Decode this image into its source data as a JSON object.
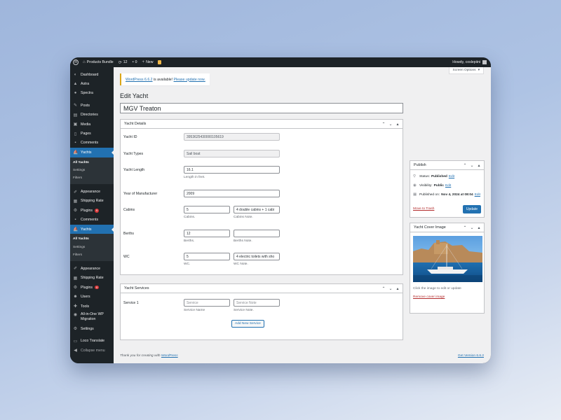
{
  "adminbar": {
    "site_name": "Products Bundle",
    "updates_count": "12",
    "comments_count": "0",
    "new_label": "New",
    "howdy": "Howdy, coslepiini"
  },
  "sidebar": {
    "items_top": [
      {
        "label": "Dashboard",
        "icon": "dashboard-icon"
      },
      {
        "label": "Astra",
        "icon": "astra-icon"
      },
      {
        "label": "Spectra",
        "icon": "spectra-icon"
      }
    ],
    "items_mid": [
      {
        "label": "Posts",
        "icon": "pin-icon"
      },
      {
        "label": "Directories",
        "icon": "directories-icon"
      },
      {
        "label": "Media",
        "icon": "media-icon"
      },
      {
        "label": "Pages",
        "icon": "pages-icon"
      },
      {
        "label": "Comments",
        "icon": "comments-icon"
      }
    ],
    "yachts_label": "Yachts",
    "submenu": [
      "All Yachts",
      "Settings",
      "Filters"
    ],
    "items_after": [
      {
        "label": "Appearance",
        "icon": "appearance-icon"
      },
      {
        "label": "Shipping Rate",
        "icon": "shipping-icon"
      },
      {
        "label": "Plugins",
        "icon": "plugins-icon",
        "badge": "9"
      },
      {
        "label": "Comments",
        "icon": "comments-icon"
      }
    ],
    "items_bottom": [
      {
        "label": "Appearance",
        "icon": "appearance-icon"
      },
      {
        "label": "Shipping Rate",
        "icon": "shipping-icon"
      },
      {
        "label": "Plugins",
        "icon": "plugins-icon",
        "badge": "9"
      },
      {
        "label": "Users",
        "icon": "users-icon"
      },
      {
        "label": "Tools",
        "icon": "tools-icon"
      },
      {
        "label": "All-in-One WP",
        "label2": "Migration",
        "icon": "migration-icon"
      },
      {
        "label": "Settings",
        "icon": "settings-icon"
      }
    ],
    "loco_label": "Loco Translate",
    "collapse_label": "Collapse menu"
  },
  "main": {
    "screen_options": "Screen Options",
    "notice_link": "WordPress 6.6.2",
    "notice_text": " is available! ",
    "notice_update_link": "Please update now.",
    "page_title": "Edit Yacht",
    "post_title": "MGV Treaton",
    "details": {
      "heading": "Yacht Details",
      "yacht_id_label": "Yacht ID",
      "yacht_id_value": "3953625430000105619",
      "types_label": "Yacht Types",
      "types_value": "Sail boat",
      "length_label": "Yacht Length",
      "length_value": "16.1",
      "length_desc": "Length in feet.",
      "year_label": "Year of Manufacturer",
      "year_value": "2009",
      "cabins_label": "Cabins",
      "cabins_value": "5",
      "cabins_desc": "Cabins.",
      "cabins_note_value": "4 double cabins + 1 cabi",
      "cabins_note_desc": "Cabins Note.",
      "berths_label": "Berths",
      "berths_value": "12",
      "berths_desc": "Berths.",
      "berths_note_value": "",
      "berths_note_desc": "Berths Note.",
      "wc_label": "WC",
      "wc_value": "5",
      "wc_desc": "WC.",
      "wc_note_value": "4 electric toilets with sho",
      "wc_note_desc": "WC Note."
    },
    "services": {
      "heading": "Yacht Services",
      "service_label": "Service 1",
      "service_placeholder": "Service",
      "service_desc": "Service Name",
      "note_placeholder": "Service Note",
      "note_desc": "Service Note.",
      "add_button": "Add New Service"
    },
    "footer_text": "Thank you for creating with ",
    "footer_link": "WordPress",
    "footer_version": "Get Version 6.6.2"
  },
  "publish": {
    "heading": "Publish",
    "status_label": "Status:",
    "status_value": "Published",
    "visibility_label": "Visibility:",
    "visibility_value": "Public",
    "published_label": "Published on:",
    "published_value": "Nov 4, 2024 at 08:04",
    "edit_label": "Edit",
    "trash_label": "Move to Trash",
    "update_label": "Update"
  },
  "cover": {
    "heading": "Yacht Cover Image",
    "hint": "Click the image to edit or update",
    "remove_label": "Remove cover image"
  },
  "colors": {
    "accent": "#2271b1",
    "sidebar": "#1d2327",
    "badge": "#d63638",
    "notice": "#dba617"
  }
}
